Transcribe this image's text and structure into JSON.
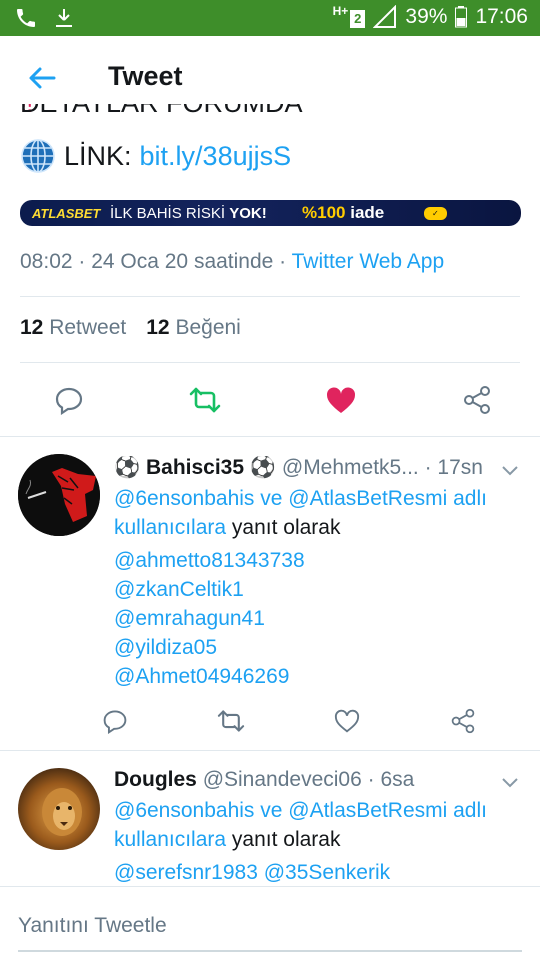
{
  "status_bar": {
    "network": "2",
    "battery": "39%",
    "time": "17:06"
  },
  "app_bar": {
    "title": "Tweet"
  },
  "tweet": {
    "cutoff_text": "DETAYLAR FORUMDA",
    "link_label": "LİNK:",
    "link_url": "bit.ly/38ujjsS",
    "banner": {
      "brand": "ATLASBET",
      "text_prefix": "İLK BAHİS RİSKİ ",
      "text_bold": "YOK!",
      "iade_pct": "%100",
      "iade_word": "iade"
    },
    "timestamp": "08:02 · 24 Oca 20 saatinde ·",
    "source": "Twitter Web App",
    "retweets_count": "12",
    "retweets_label": "Retweet",
    "likes_count": "12",
    "likes_label": "Beğeni"
  },
  "replies": [
    {
      "display_name": "⚽ Bahisci35 ⚽",
      "handle": "@Mehmetk5...",
      "time": "· 17sn",
      "reply_to_users": "@6ensonbahis ve @AtlasBetResmi adlı kullanıcılara",
      "reply_suffix": "yanıt olarak",
      "mentions": [
        "@ahmetto81343738",
        "@zkanCeltik1",
        "@emrahagun41",
        "@yildiza05",
        "@Ahmet04946269"
      ]
    },
    {
      "display_name": "Dougles",
      "handle": "@Sinandeveci06",
      "time": "· 6sa",
      "reply_to_users": "@6ensonbahis ve @AtlasBetResmi adlı kullanıcılara",
      "reply_suffix": "yanıt olarak",
      "mentions_inline": "@serefsnr1983 @35Senkerik"
    }
  ],
  "reply_input": {
    "placeholder": "Yanıtını Tweetle"
  },
  "colors": {
    "status_bar": "#3e8e2a",
    "twitter_blue": "#1da1f2",
    "retweet_green": "#17bf63",
    "like_red": "#e0245e",
    "secondary_text": "#657786"
  }
}
